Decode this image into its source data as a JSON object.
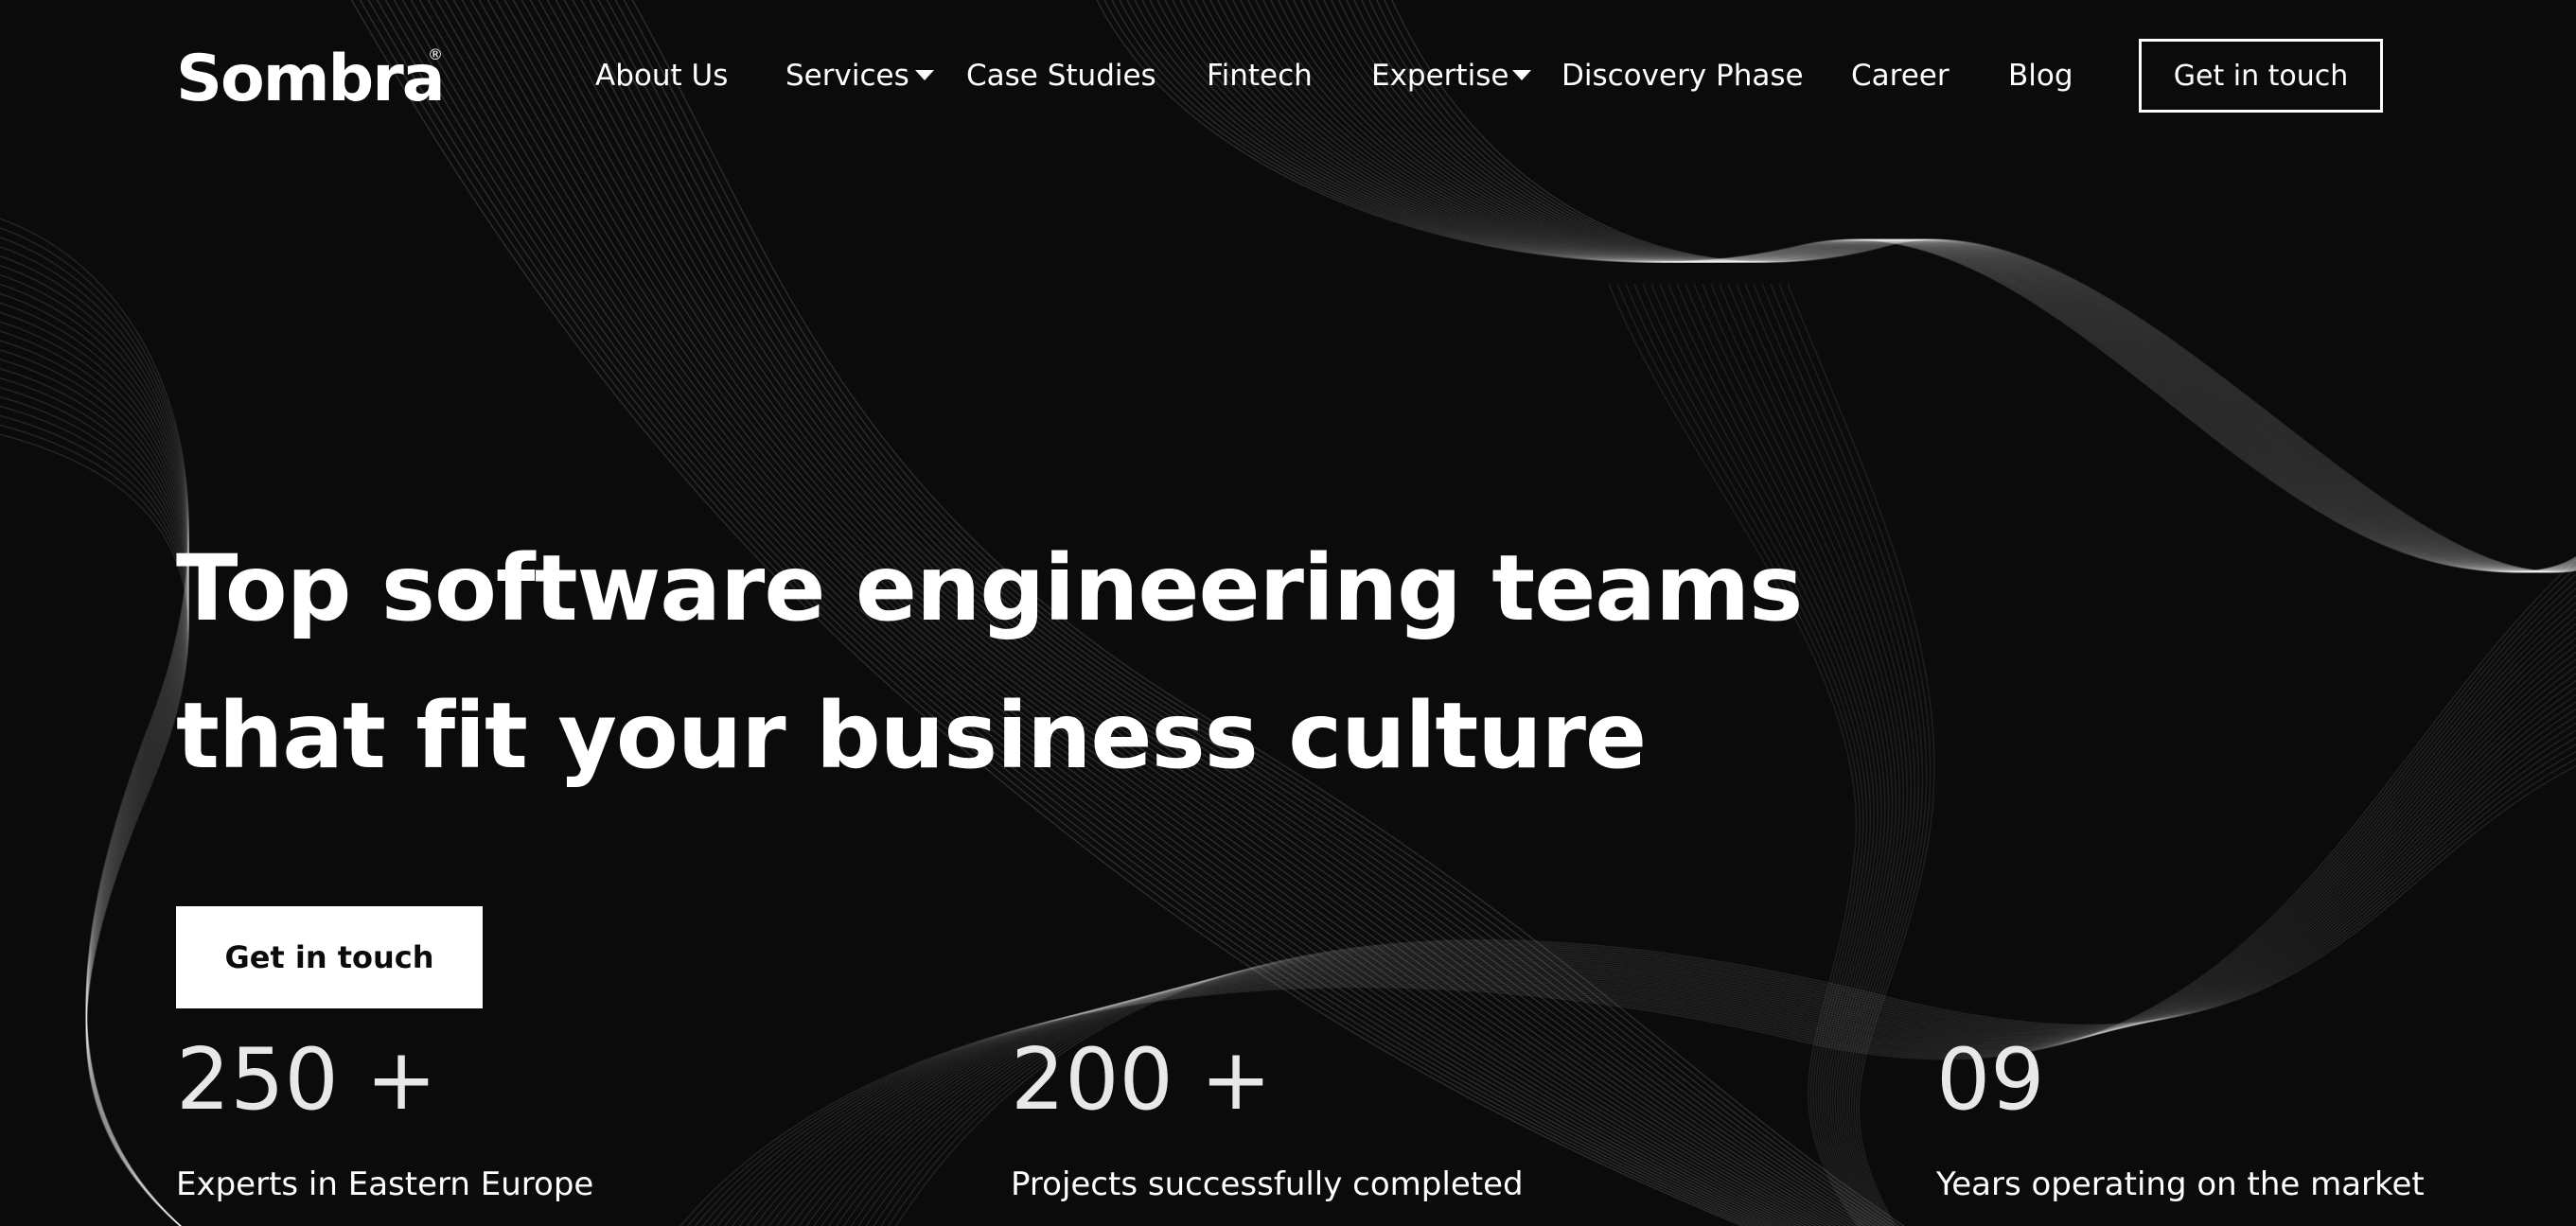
{
  "theme": {
    "background": "#0b0b0b",
    "text": "#ffffff",
    "cta_background": "#ffffff",
    "cta_text": "#0b0b0b"
  },
  "header": {
    "logo_text": "Sombra",
    "logo_mark": "®",
    "nav": [
      {
        "label": "About Us",
        "has_dropdown": false
      },
      {
        "label": "Services",
        "has_dropdown": true
      },
      {
        "label": "Case Studies",
        "has_dropdown": false
      },
      {
        "label": "Fintech",
        "has_dropdown": false
      },
      {
        "label": "Expertise",
        "has_dropdown": true
      },
      {
        "label": "Discovery Phase",
        "has_dropdown": false
      },
      {
        "label": "Career",
        "has_dropdown": false
      },
      {
        "label": "Blog",
        "has_dropdown": false
      }
    ],
    "cta_label": "Get in touch"
  },
  "hero": {
    "headline_line1": "Top software engineering teams",
    "headline_line2": "that fit your business culture",
    "cta_label": "Get in touch"
  },
  "stats": [
    {
      "value": "250 +",
      "label": "Experts in Eastern Europe"
    },
    {
      "value": "200 +",
      "label": "Projects successfully completed"
    },
    {
      "value": "09",
      "label": "Years operating on the market"
    }
  ],
  "icons": {
    "dropdown": "caret-down-icon"
  }
}
